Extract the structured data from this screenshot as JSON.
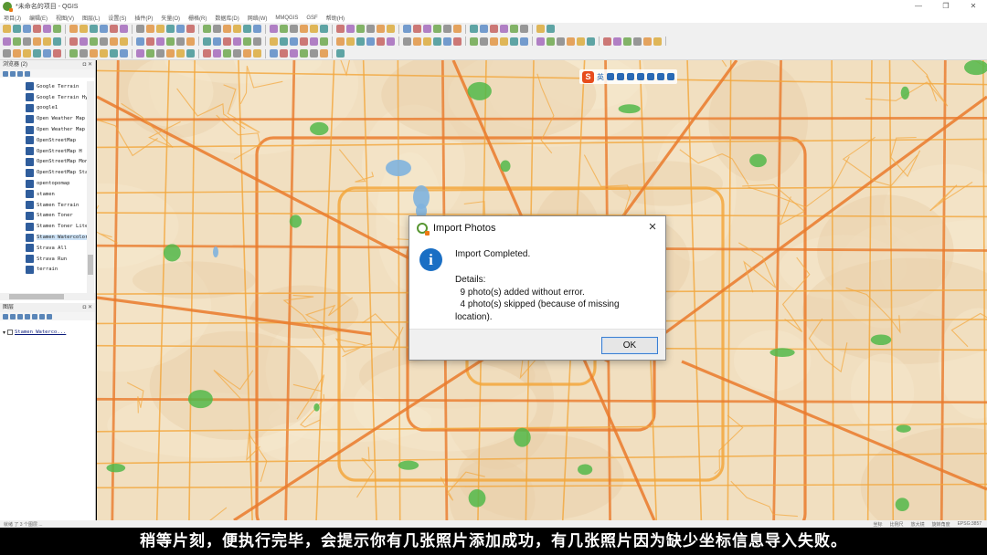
{
  "window": {
    "title": "*未命名的项目 - QGIS",
    "minimize": "—",
    "maximize": "❐",
    "close": "✕"
  },
  "menu": [
    "项目(J)",
    "编辑(E)",
    "视图(V)",
    "图层(L)",
    "设置(S)",
    "插件(P)",
    "矢量(O)",
    "栅格(R)",
    "数据库(D)",
    "网络(W)",
    "MMQGIS",
    "GSF",
    "帮助(H)"
  ],
  "browser": {
    "title": "浏览器 (2)",
    "items": [
      "Google Terrain",
      "Google Terrain Hybrid",
      "google1",
      "Open Weather Map",
      "Open Weather Map",
      "OpenStreetMap",
      "OpenStreetMap H",
      "OpenStreetMap Monochrome",
      "OpenStreetMap Standard",
      "opentopomap",
      "stamen",
      "Stamen Terrain",
      "Stamen Toner",
      "Stamen Toner Lite",
      "Stamen Watercolor",
      "Strava All",
      "Strava Run",
      "terrain"
    ],
    "selected_index": 14
  },
  "layers": {
    "title": "图层",
    "items": [
      {
        "name": "Stamen Waterco...",
        "checked": true
      }
    ]
  },
  "ime": {
    "logo": "S",
    "mode": "英"
  },
  "dialog": {
    "title": "Import Photos",
    "icon": "i",
    "message": "Import Completed.",
    "details": "Details:\n  9 photo(s) added without error.\n  4 photo(s) skipped (because of missing\nlocation).",
    "ok_label": "OK",
    "close_label": "×"
  },
  "statusbar": {
    "left": "就绪 了 3 个图层 ...",
    "coord_label": "坐标",
    "scale_label": "比例尺",
    "magnifier_label": "放大镜",
    "rotation_label": "旋转角度",
    "epsg": "EPSG:3857"
  },
  "subtitle": "稍等片刻，便执行完毕，会提示你有几张照片添加成功，有几张照片因为缺少坐标信息导入失败。",
  "colors": {
    "map_bg": "#f1dfc0",
    "road": "#f3a73c",
    "major_road": "#ea7b2c",
    "park": "#52b84a",
    "water": "#7fb3de",
    "info_icon": "#1a6fc4"
  }
}
